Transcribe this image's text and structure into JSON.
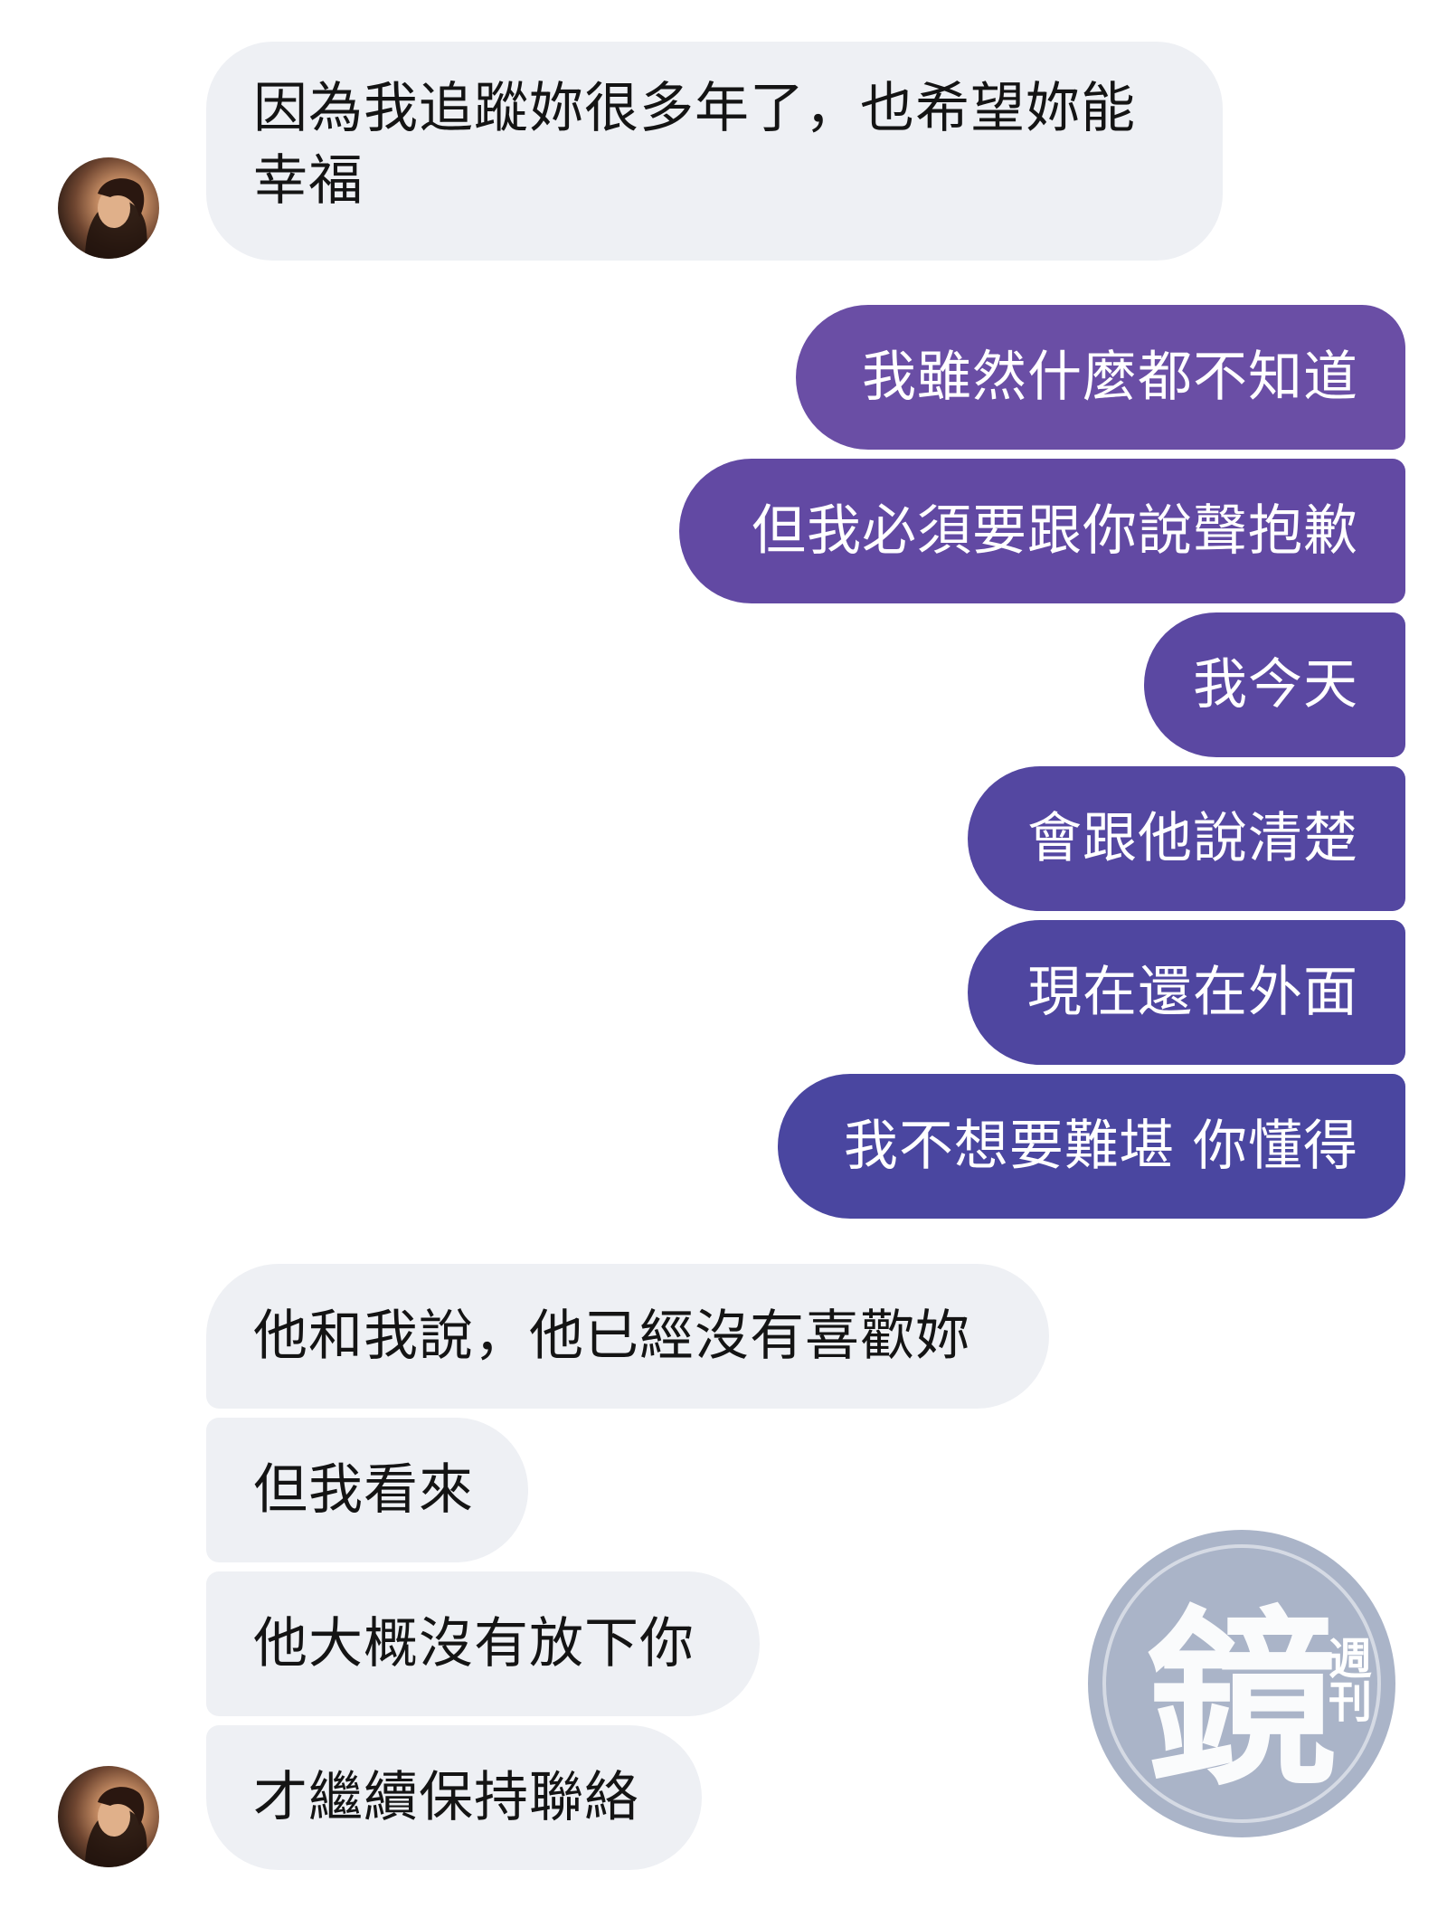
{
  "chat": {
    "messages": [
      {
        "side": "incoming",
        "text": "因為我追蹤妳很多年了，也希望妳能幸福"
      },
      {
        "side": "outgoing",
        "text": "我雖然什麼都不知道"
      },
      {
        "side": "outgoing",
        "text": "但我必須要跟你說聲抱歉"
      },
      {
        "side": "outgoing",
        "text": "我今天"
      },
      {
        "side": "outgoing",
        "text": "會跟他說清楚"
      },
      {
        "side": "outgoing",
        "text": "現在還在外面"
      },
      {
        "side": "outgoing",
        "text": "我不想要難堪 你懂得"
      },
      {
        "side": "incoming",
        "text": "他和我說，他已經沒有喜歡妳"
      },
      {
        "side": "incoming",
        "text": "但我看來"
      },
      {
        "side": "incoming",
        "text": "他大概沒有放下你"
      },
      {
        "side": "incoming",
        "text": "才繼續保持聯絡"
      }
    ]
  },
  "colors": {
    "incoming_bubble": "#eef0f4",
    "outgoing_gradient_top": "#6f4fa6",
    "outgoing_gradient_bottom": "#4a46a0"
  },
  "watermark": {
    "main": "鏡",
    "sub": "週刊"
  }
}
